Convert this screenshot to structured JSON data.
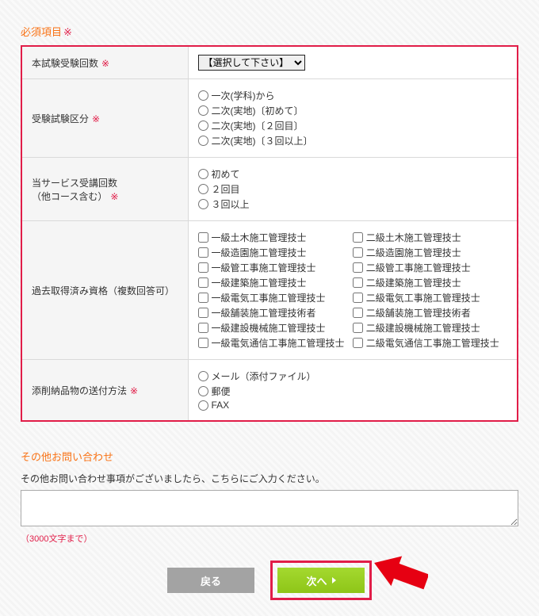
{
  "required_section_title": "必須項目",
  "rows": {
    "exam_count": {
      "label": "本試験受験回数",
      "select_placeholder": "【選択して下さい】"
    },
    "exam_category": {
      "label": "受験試験区分",
      "options": [
        "一次(学科)から",
        "二次(実地)〔初めて〕",
        "二次(実地)〔２回目〕",
        "二次(実地)〔３回以上〕"
      ]
    },
    "service_count": {
      "label_line1": "当サービス受講回数",
      "label_line2": "（他コース含む）",
      "options": [
        "初めて",
        "２回目",
        "３回以上"
      ]
    },
    "past_quals": {
      "label": "過去取得済み資格（複数回答可）",
      "col_a": [
        "一級土木施工管理技士",
        "一級造園施工管理技士",
        "一級管工事施工管理技士",
        "一級建築施工管理技士",
        "一級電気工事施工管理技士",
        "一級舗装施工管理技術者",
        "一級建設機械施工管理技士",
        "一級電気通信工事施工管理技士"
      ],
      "col_b": [
        "二級土木施工管理技士",
        "二級造園施工管理技士",
        "二級管工事施工管理技士",
        "二級建築施工管理技士",
        "二級電気工事施工管理技士",
        "二級舗装施工管理技術者",
        "二級建設機械施工管理技士",
        "二級電気通信工事施工管理技士"
      ]
    },
    "delivery": {
      "label": "添削納品物の送付方法",
      "options": [
        "メール（添付ファイル）",
        "郵便",
        "FAX"
      ]
    }
  },
  "other_title": "その他お問い合わせ",
  "other_desc": "その他お問い合わせ事項がございましたら、こちらにご入力ください。",
  "char_limit": "（3000文字まで）",
  "buttons": {
    "back": "戻る",
    "next": "次へ"
  }
}
